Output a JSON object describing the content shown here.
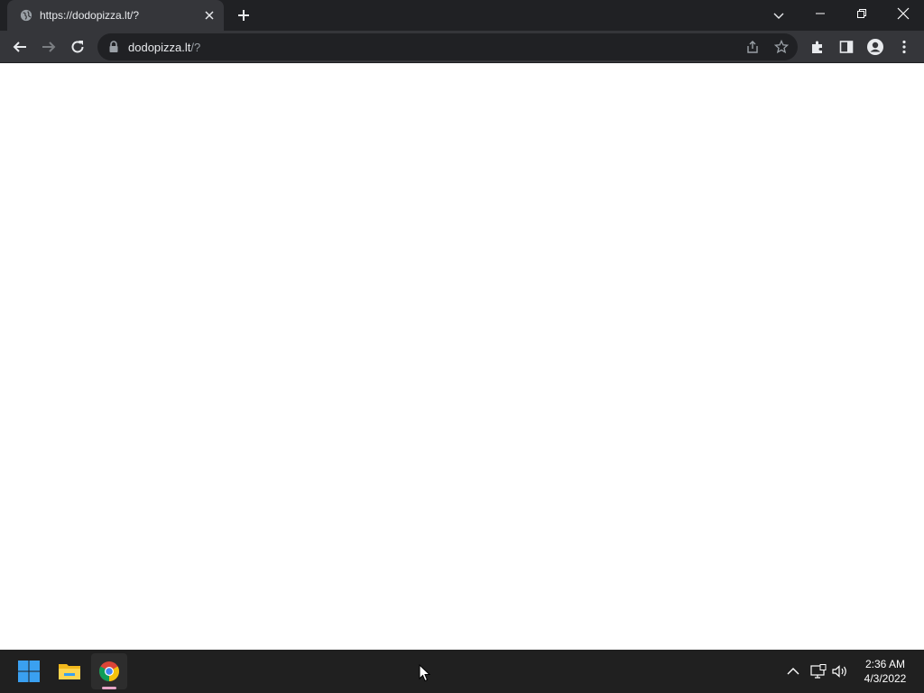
{
  "browser": {
    "tab": {
      "title": "https://dodopizza.lt/?",
      "favicon": "globe-icon"
    },
    "omnibox": {
      "host": "dodopizza.lt",
      "path": "/?"
    }
  },
  "taskbar": {
    "apps": [
      "windows-start-icon",
      "file-explorer-icon",
      "chrome-icon"
    ],
    "clock": {
      "time": "2:36 AM",
      "date": "4/3/2022"
    }
  },
  "colors": {
    "tabstrip": "#202124",
    "toolbar": "#35363a",
    "taskbar": "#202020",
    "page": "#ffffff"
  }
}
